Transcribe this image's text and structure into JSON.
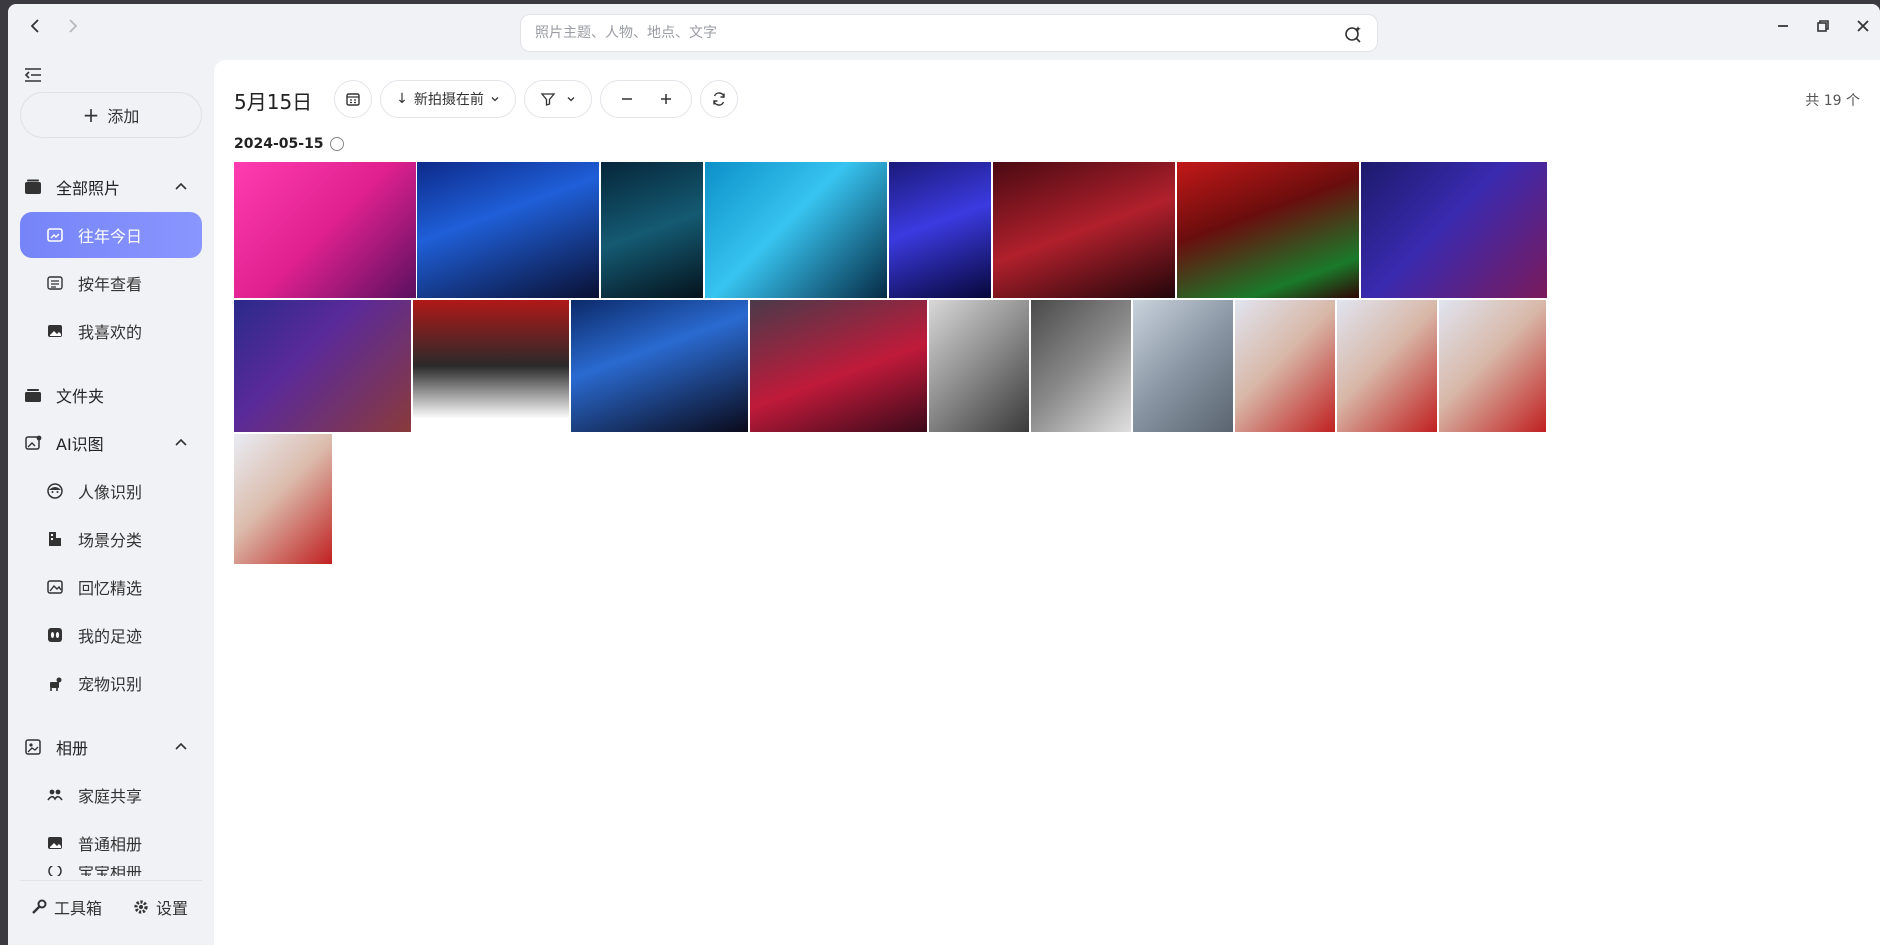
{
  "search": {
    "placeholder": "照片主题、人物、地点、文字"
  },
  "sidebar": {
    "add_label": "添加",
    "all_photos": "全部照片",
    "on_this_day": "往年今日",
    "by_year": "按年查看",
    "favorites": "我喜欢的",
    "folders": "文件夹",
    "ai_group": "AI识图",
    "face": "人像识别",
    "scene": "场景分类",
    "memories": "回忆精选",
    "footprints": "我的足迹",
    "pets": "宠物识别",
    "albums_group": "相册",
    "family_share": "家庭共享",
    "normal_album": "普通相册",
    "smart_album": "宝宝相册",
    "toolbox": "工具箱",
    "settings": "设置"
  },
  "main": {
    "date_title": "5月15日",
    "sort_label": "新拍摄在前",
    "count_label": "共 19 个",
    "day_label": "2024-05-15"
  },
  "colors": {
    "accent": "#7584f8",
    "sidebar_bg": "#f1f2f6",
    "main_bg": "#ffffff"
  },
  "photos": [
    {
      "name": "concert-pink-stage",
      "bg": "linear-gradient(135deg,#ff3cb0,#e0208f 50%,#5a1060)"
    },
    {
      "name": "concert-blue-duo",
      "bg": "linear-gradient(160deg,#0d2a8a,#1f5fd8 40%,#0a1033)"
    },
    {
      "name": "concert-dark-duo",
      "bg": "linear-gradient(160deg,#06263a,#145a72 50%,#05121c)"
    },
    {
      "name": "concert-cyan-singer",
      "bg": "linear-gradient(135deg,#0c90c8,#37c4f0 45%,#062a44)"
    },
    {
      "name": "concert-purple-singer",
      "bg": "linear-gradient(160deg,#1b1a7a,#3b3ae0 45%,#07073a)"
    },
    {
      "name": "concert-red-lights",
      "bg": "linear-gradient(160deg,#4a0a12,#b0202c 50%,#22060a)"
    },
    {
      "name": "concert-red-banner",
      "bg": "linear-gradient(160deg,#c31818,#6a0d0d 40%,#1a7a2a 80%,#300505)"
    },
    {
      "name": "led-birthday-sign",
      "bg": "linear-gradient(135deg,#1c1a6a,#3a2ab0 45%,#7a1a5a)"
    },
    {
      "name": "led-birthday-doll",
      "bg": "linear-gradient(135deg,#2a2a8a,#5a2a9a 40%,#8a3a3a)"
    },
    {
      "name": "stage-photo-print",
      "bg": "linear-gradient(180deg,#b01818,#2a2a2a 50%,#ffffff 90%)"
    },
    {
      "name": "concert-blue-beams",
      "bg": "linear-gradient(160deg,#0c2a6a,#2a6ad0 40%,#0a0a1a)"
    },
    {
      "name": "concert-crowd-red",
      "bg": "linear-gradient(160deg,#4a3a4a,#c01a3a 55%,#3a0a1a)"
    },
    {
      "name": "dinner-plates",
      "bg": "linear-gradient(135deg,#d8d8d8,#8a8a8a 50%,#3a3a3a)"
    },
    {
      "name": "dinner-table",
      "bg": "linear-gradient(135deg,#4a4a4a,#8a8a8a 50%,#e0e0e0)"
    },
    {
      "name": "airplane-window",
      "bg": "linear-gradient(135deg,#c8d2dc,#8a96a4 50%,#5a6470)"
    },
    {
      "name": "child-laughing-1",
      "bg": "linear-gradient(135deg,#e0e4f0,#d8b8a8 45%,#c02020)"
    },
    {
      "name": "child-laughing-2",
      "bg": "linear-gradient(135deg,#e0e4f0,#d8b8a8 45%,#c02020)"
    },
    {
      "name": "child-laughing-3",
      "bg": "linear-gradient(135deg,#e0e4f0,#d8b8a8 45%,#c02020)"
    },
    {
      "name": "child-laughing-4",
      "bg": "linear-gradient(135deg,#e8ecf4,#dcbcac 45%,#c02020)"
    }
  ]
}
